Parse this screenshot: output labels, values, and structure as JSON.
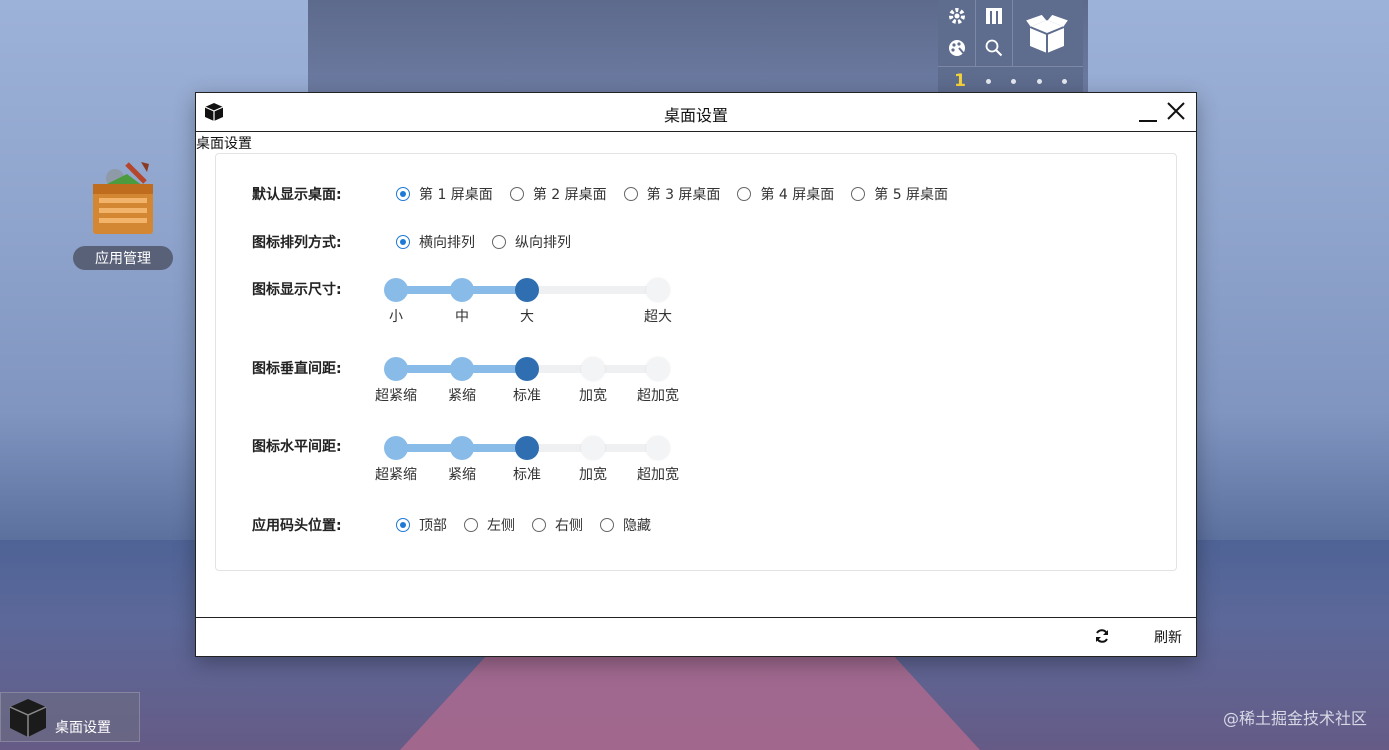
{
  "launcher": {
    "icons": [
      "gear-icon",
      "grid-icon",
      "palette-icon",
      "search-icon",
      "box-icon"
    ],
    "current_page": "1",
    "dot_count": 4
  },
  "desktop": {
    "app_icon_label": "应用管理"
  },
  "dialog": {
    "title": "桌面设置",
    "breadcrumb": "桌面设置",
    "default_screen": {
      "label": "默认显示桌面:",
      "options": [
        "第 1 屏桌面",
        "第 2 屏桌面",
        "第 3 屏桌面",
        "第 4 屏桌面",
        "第 5 屏桌面"
      ],
      "selected": 0
    },
    "arrange": {
      "label": "图标排列方式:",
      "options": [
        "横向排列",
        "纵向排列"
      ],
      "selected": 0
    },
    "icon_size": {
      "label": "图标显示尺寸:",
      "ticks": [
        "小",
        "中",
        "大",
        "超大"
      ],
      "value": 2
    },
    "vertical_spacing": {
      "label": "图标垂直间距:",
      "ticks": [
        "超紧缩",
        "紧缩",
        "标准",
        "加宽",
        "超加宽"
      ],
      "value": 2
    },
    "horizontal_spacing": {
      "label": "图标水平间距:",
      "ticks": [
        "超紧缩",
        "紧缩",
        "标准",
        "加宽",
        "超加宽"
      ],
      "value": 2
    },
    "dock_position": {
      "label": "应用码头位置:",
      "options": [
        "顶部",
        "左侧",
        "右侧",
        "隐藏"
      ],
      "selected": 0
    },
    "footer": {
      "refresh_label": "刷新"
    }
  },
  "taskbar": {
    "item_label": "桌面设置"
  },
  "watermark": "@稀土掘金技术社区"
}
